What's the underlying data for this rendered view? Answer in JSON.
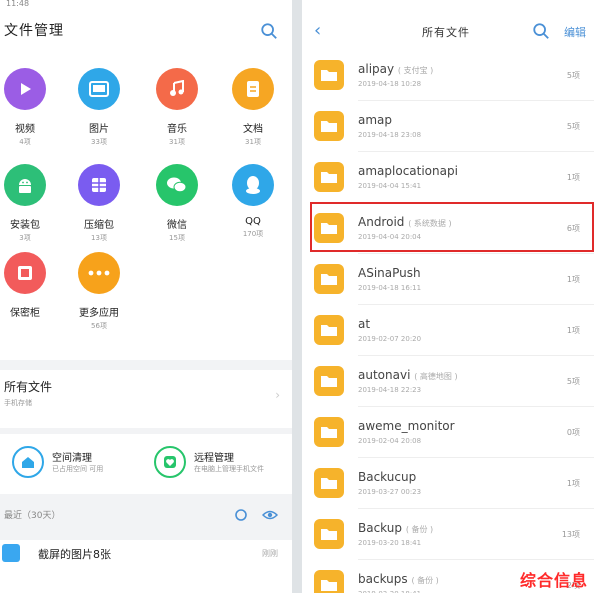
{
  "left": {
    "status_time": "11:48",
    "title": "文件管理",
    "categories": [
      {
        "label": "视频",
        "count": "4项",
        "color": "#9b5de5",
        "icon": "play-icon"
      },
      {
        "label": "图片",
        "count": "33项",
        "color": "#2fa7e8",
        "icon": "image-icon"
      },
      {
        "label": "音乐",
        "count": "31项",
        "color": "#f46a49",
        "icon": "music-icon"
      },
      {
        "label": "文档",
        "count": "31项",
        "color": "#f6a623",
        "icon": "document-icon"
      },
      {
        "label": "安装包",
        "count": "3项",
        "color": "#2dbf78",
        "icon": "android-icon"
      },
      {
        "label": "压缩包",
        "count": "13项",
        "color": "#7a5cf0",
        "icon": "archive-icon"
      },
      {
        "label": "微信",
        "count": "15项",
        "color": "#27c56b",
        "icon": "wechat-icon"
      },
      {
        "label": "QQ",
        "count": "170项",
        "color": "#2fa7e8",
        "icon": "qq-icon"
      },
      {
        "label": "保密柜",
        "count": "",
        "color": "#f25b5b",
        "icon": "safe-icon"
      },
      {
        "label": "更多应用",
        "count": "56项",
        "color": "#f7a21b",
        "icon": "more-icon"
      }
    ],
    "all_files": {
      "title": "所有文件",
      "subtitle": "手机存储"
    },
    "quick": [
      {
        "title": "空间清理",
        "subtitle": "已占用空间 可用",
        "color": "#2fa7e8",
        "icon": "home-icon"
      },
      {
        "title": "远程管理",
        "subtitle": "在电脑上管理手机文件",
        "color": "#27c56b",
        "icon": "heart-icon"
      }
    ],
    "recent": {
      "label": "最近（30天）"
    },
    "recent_item": {
      "title": "截屏的图片8张",
      "right": "刚刚"
    }
  },
  "right": {
    "title": "所有文件",
    "edit": "编辑",
    "folders": [
      {
        "name": "alipay",
        "tag": "( 支付宝 )",
        "date": "2019-04-18 10:28",
        "count": "5项"
      },
      {
        "name": "amap",
        "tag": "",
        "date": "2019-04-18 23:08",
        "count": "5项"
      },
      {
        "name": "amaplocationapi",
        "tag": "",
        "date": "2019-04-04 15:41",
        "count": "1项"
      },
      {
        "name": "Android",
        "tag": "( 系统数据 )",
        "date": "2019-04-04 20:04",
        "count": "6项"
      },
      {
        "name": "ASinaPush",
        "tag": "",
        "date": "2019-04-18 16:11",
        "count": "1项"
      },
      {
        "name": "at",
        "tag": "",
        "date": "2019-02-07 20:20",
        "count": "1项"
      },
      {
        "name": "autonavi",
        "tag": "( 高德地图 )",
        "date": "2019-04-18 22:23",
        "count": "5项"
      },
      {
        "name": "aweme_monitor",
        "tag": "",
        "date": "2019-02-04 20:08",
        "count": "0项"
      },
      {
        "name": "Backucup",
        "tag": "",
        "date": "2019-03-27 00:23",
        "count": "1项"
      },
      {
        "name": "Backup",
        "tag": "( 备份 )",
        "date": "2019-03-20 18:41",
        "count": "13项"
      },
      {
        "name": "backups",
        "tag": "( 备份 )",
        "date": "2019-03-20 18:41",
        "count": "2项"
      }
    ]
  },
  "watermark": "综合信息"
}
